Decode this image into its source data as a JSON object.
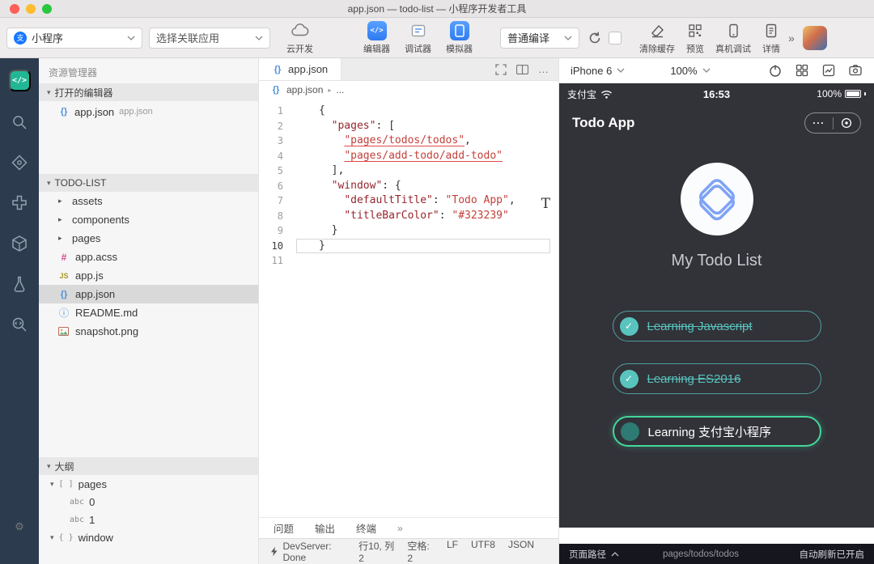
{
  "window": {
    "title": "app.json — todo-list — 小程序开发者工具"
  },
  "icons": {
    "code_glyph": "</>",
    "json_braces": "{}",
    "gear": "⚙",
    "check": "✓",
    "section_caret": "▾",
    "folder_caret": "▸",
    "breadcrumb_sep": "▸",
    "more_dots": "…"
  },
  "file_icons": {
    "json": "{}",
    "acss": "#",
    "js": "JS",
    "info": "ⓘ"
  },
  "toolbar": {
    "app_select_label": "小程序",
    "relation_select_label": "选择关联应用",
    "cloud_label": "云开发",
    "editor_label": "编辑器",
    "debugger_label": "调试器",
    "simulator_label": "模拟器",
    "compile_select_label": "普通编译",
    "clear_cache_label": "清除缓存",
    "preview_label": "预览",
    "device_debug_label": "真机调试",
    "detail_label": "详情",
    "overflow_glyph": "»"
  },
  "explorer": {
    "title": "资源管理器",
    "open_editors_label": "打开的编辑器",
    "open_editors": [
      {
        "name": "app.json",
        "path": "app.json"
      }
    ],
    "project_label": "TODO-LIST",
    "tree": [
      {
        "name": "assets",
        "kind": "folder"
      },
      {
        "name": "components",
        "kind": "folder"
      },
      {
        "name": "pages",
        "kind": "folder"
      },
      {
        "name": "app.acss",
        "kind": "file",
        "icon": "acss"
      },
      {
        "name": "app.js",
        "kind": "file",
        "icon": "js"
      },
      {
        "name": "app.json",
        "kind": "file",
        "icon": "json",
        "selected": true
      },
      {
        "name": "README.md",
        "kind": "file",
        "icon": "info"
      },
      {
        "name": "snapshot.png",
        "kind": "file",
        "icon": "image"
      }
    ],
    "outline_label": "大纲",
    "outline": [
      {
        "label": "pages",
        "icon": "[ ]",
        "caret": true,
        "child": false
      },
      {
        "label": "0",
        "icon": "abc",
        "caret": false,
        "child": true
      },
      {
        "label": "1",
        "icon": "abc",
        "caret": false,
        "child": true
      },
      {
        "label": "window",
        "icon": "{ }",
        "caret": true,
        "child": false
      }
    ]
  },
  "editor": {
    "tab_label": "app.json",
    "breadcrumb_file": "app.json",
    "breadcrumb_more": "...",
    "active_line": 10,
    "stray_mark": "T",
    "lines": [
      {
        "num": 1,
        "tokens": [
          {
            "t": "{",
            "c": "p"
          }
        ]
      },
      {
        "num": 2,
        "tokens": [
          {
            "t": "  ",
            "c": "p"
          },
          {
            "t": "\"pages\"",
            "c": "k"
          },
          {
            "t": ": [",
            "c": "p"
          }
        ]
      },
      {
        "num": 3,
        "tokens": [
          {
            "t": "    ",
            "c": "p"
          },
          {
            "t": "\"pages/todos/todos\"",
            "c": "s e"
          },
          {
            "t": ",",
            "c": "p"
          }
        ]
      },
      {
        "num": 4,
        "tokens": [
          {
            "t": "    ",
            "c": "p"
          },
          {
            "t": "\"pages/add-todo/add-todo\"",
            "c": "s e"
          }
        ]
      },
      {
        "num": 5,
        "tokens": [
          {
            "t": "  ],",
            "c": "p"
          }
        ]
      },
      {
        "num": 6,
        "tokens": [
          {
            "t": "  ",
            "c": "p"
          },
          {
            "t": "\"window\"",
            "c": "k"
          },
          {
            "t": ": {",
            "c": "p"
          }
        ]
      },
      {
        "num": 7,
        "tokens": [
          {
            "t": "    ",
            "c": "p"
          },
          {
            "t": "\"defaultTitle\"",
            "c": "k"
          },
          {
            "t": ": ",
            "c": "p"
          },
          {
            "t": "\"Todo App\"",
            "c": "s"
          },
          {
            "t": ",",
            "c": "p"
          }
        ]
      },
      {
        "num": 8,
        "tokens": [
          {
            "t": "    ",
            "c": "p"
          },
          {
            "t": "\"titleBarColor\"",
            "c": "k"
          },
          {
            "t": ": ",
            "c": "p"
          },
          {
            "t": "\"#323239\"",
            "c": "s"
          }
        ]
      },
      {
        "num": 9,
        "tokens": [
          {
            "t": "  }",
            "c": "p"
          }
        ]
      },
      {
        "num": 10,
        "tokens": [
          {
            "t": "}",
            "c": "p"
          }
        ]
      },
      {
        "num": 11,
        "tokens": []
      }
    ],
    "panel_tabs": [
      "问题",
      "输出",
      "终端"
    ],
    "panel_more_glyph": "»",
    "status_left": "DevServer: Done",
    "status_items": [
      "行10, 列2",
      "空格: 2",
      "LF",
      "UTF8",
      "JSON"
    ]
  },
  "simulator": {
    "device_label": "iPhone 6",
    "zoom_label": "100%",
    "phone": {
      "carrier": "支付宝",
      "time": "16:53",
      "battery": "100%",
      "nav_title": "Todo App",
      "more_glyph": "···",
      "app_title": "My Todo List",
      "todos": [
        {
          "label": "Learning Javascript",
          "done": true
        },
        {
          "label": "Learning ES2016",
          "done": true
        },
        {
          "label": "Learning 支付宝小程序",
          "done": false
        }
      ]
    },
    "footer_left": "页面路径",
    "footer_path": "pages/todos/todos",
    "footer_right": "自动刷新已开启"
  },
  "colors": {
    "phone_bg": "#323239",
    "teal": "#58c4bd",
    "green": "#43d89c",
    "accent_blue": "#1677ff"
  }
}
